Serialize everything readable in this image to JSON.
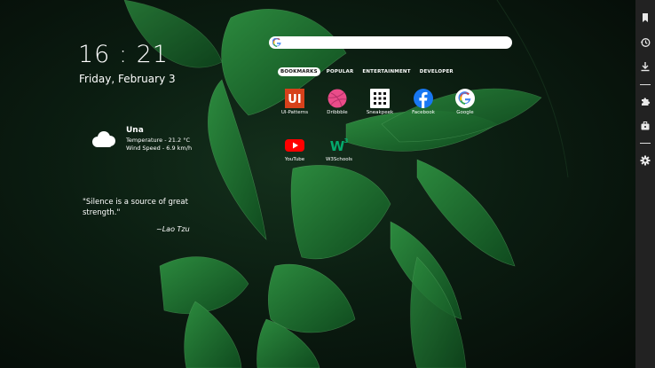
{
  "clock": {
    "time": "16 : 21",
    "date": "Friday, February 3"
  },
  "weather": {
    "location": "Una",
    "temperature": "Temperature - 21.2 °C",
    "wind": "Wind Speed - 6.9 km/h",
    "icon": "cloud-icon"
  },
  "quote": {
    "text": "\"Silence is a source of great strength.\"",
    "author": "~Lao Tzu"
  },
  "search": {
    "placeholder": "",
    "value": ""
  },
  "tabs": [
    "BOOKMARKS",
    "POPULAR",
    "ENTERTAINMENT",
    "DEVELOPER"
  ],
  "active_tab": "BOOKMARKS",
  "bookmarks": [
    {
      "label": "UI-Patterns",
      "icon": "ui-patterns-icon",
      "color": "#d6411b"
    },
    {
      "label": "Dribbble",
      "icon": "dribbble-icon",
      "color": "#ea4c89"
    },
    {
      "label": "Sneakpeek",
      "icon": "sneakpeek-icon",
      "color": "#ffffff"
    },
    {
      "label": "Facebook",
      "icon": "facebook-icon",
      "color": "#1877f2"
    },
    {
      "label": "Google",
      "icon": "google-icon",
      "color": "#ffffff"
    },
    {
      "label": "YouTube",
      "icon": "youtube-icon",
      "color": "#ff0000"
    },
    {
      "label": "W3Schools",
      "icon": "w3schools-icon",
      "color": "#04aa6d"
    }
  ],
  "sidebar": {
    "icons": [
      "bookmark-icon",
      "history-icon",
      "download-icon",
      "extension-icon",
      "toolbox-icon",
      "settings-icon"
    ]
  }
}
